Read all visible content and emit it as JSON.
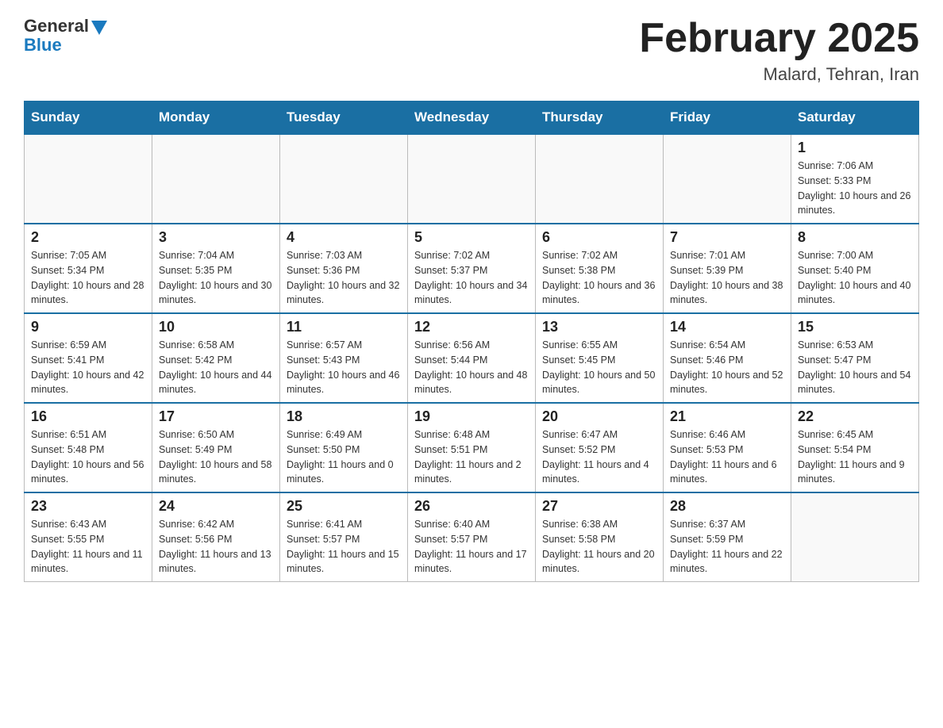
{
  "header": {
    "logo_general": "General",
    "logo_blue": "Blue",
    "month_title": "February 2025",
    "location": "Malard, Tehran, Iran"
  },
  "days_of_week": [
    "Sunday",
    "Monday",
    "Tuesday",
    "Wednesday",
    "Thursday",
    "Friday",
    "Saturday"
  ],
  "weeks": [
    [
      {
        "day": "",
        "sunrise": "",
        "sunset": "",
        "daylight": ""
      },
      {
        "day": "",
        "sunrise": "",
        "sunset": "",
        "daylight": ""
      },
      {
        "day": "",
        "sunrise": "",
        "sunset": "",
        "daylight": ""
      },
      {
        "day": "",
        "sunrise": "",
        "sunset": "",
        "daylight": ""
      },
      {
        "day": "",
        "sunrise": "",
        "sunset": "",
        "daylight": ""
      },
      {
        "day": "",
        "sunrise": "",
        "sunset": "",
        "daylight": ""
      },
      {
        "day": "1",
        "sunrise": "Sunrise: 7:06 AM",
        "sunset": "Sunset: 5:33 PM",
        "daylight": "Daylight: 10 hours and 26 minutes."
      }
    ],
    [
      {
        "day": "2",
        "sunrise": "Sunrise: 7:05 AM",
        "sunset": "Sunset: 5:34 PM",
        "daylight": "Daylight: 10 hours and 28 minutes."
      },
      {
        "day": "3",
        "sunrise": "Sunrise: 7:04 AM",
        "sunset": "Sunset: 5:35 PM",
        "daylight": "Daylight: 10 hours and 30 minutes."
      },
      {
        "day": "4",
        "sunrise": "Sunrise: 7:03 AM",
        "sunset": "Sunset: 5:36 PM",
        "daylight": "Daylight: 10 hours and 32 minutes."
      },
      {
        "day": "5",
        "sunrise": "Sunrise: 7:02 AM",
        "sunset": "Sunset: 5:37 PM",
        "daylight": "Daylight: 10 hours and 34 minutes."
      },
      {
        "day": "6",
        "sunrise": "Sunrise: 7:02 AM",
        "sunset": "Sunset: 5:38 PM",
        "daylight": "Daylight: 10 hours and 36 minutes."
      },
      {
        "day": "7",
        "sunrise": "Sunrise: 7:01 AM",
        "sunset": "Sunset: 5:39 PM",
        "daylight": "Daylight: 10 hours and 38 minutes."
      },
      {
        "day": "8",
        "sunrise": "Sunrise: 7:00 AM",
        "sunset": "Sunset: 5:40 PM",
        "daylight": "Daylight: 10 hours and 40 minutes."
      }
    ],
    [
      {
        "day": "9",
        "sunrise": "Sunrise: 6:59 AM",
        "sunset": "Sunset: 5:41 PM",
        "daylight": "Daylight: 10 hours and 42 minutes."
      },
      {
        "day": "10",
        "sunrise": "Sunrise: 6:58 AM",
        "sunset": "Sunset: 5:42 PM",
        "daylight": "Daylight: 10 hours and 44 minutes."
      },
      {
        "day": "11",
        "sunrise": "Sunrise: 6:57 AM",
        "sunset": "Sunset: 5:43 PM",
        "daylight": "Daylight: 10 hours and 46 minutes."
      },
      {
        "day": "12",
        "sunrise": "Sunrise: 6:56 AM",
        "sunset": "Sunset: 5:44 PM",
        "daylight": "Daylight: 10 hours and 48 minutes."
      },
      {
        "day": "13",
        "sunrise": "Sunrise: 6:55 AM",
        "sunset": "Sunset: 5:45 PM",
        "daylight": "Daylight: 10 hours and 50 minutes."
      },
      {
        "day": "14",
        "sunrise": "Sunrise: 6:54 AM",
        "sunset": "Sunset: 5:46 PM",
        "daylight": "Daylight: 10 hours and 52 minutes."
      },
      {
        "day": "15",
        "sunrise": "Sunrise: 6:53 AM",
        "sunset": "Sunset: 5:47 PM",
        "daylight": "Daylight: 10 hours and 54 minutes."
      }
    ],
    [
      {
        "day": "16",
        "sunrise": "Sunrise: 6:51 AM",
        "sunset": "Sunset: 5:48 PM",
        "daylight": "Daylight: 10 hours and 56 minutes."
      },
      {
        "day": "17",
        "sunrise": "Sunrise: 6:50 AM",
        "sunset": "Sunset: 5:49 PM",
        "daylight": "Daylight: 10 hours and 58 minutes."
      },
      {
        "day": "18",
        "sunrise": "Sunrise: 6:49 AM",
        "sunset": "Sunset: 5:50 PM",
        "daylight": "Daylight: 11 hours and 0 minutes."
      },
      {
        "day": "19",
        "sunrise": "Sunrise: 6:48 AM",
        "sunset": "Sunset: 5:51 PM",
        "daylight": "Daylight: 11 hours and 2 minutes."
      },
      {
        "day": "20",
        "sunrise": "Sunrise: 6:47 AM",
        "sunset": "Sunset: 5:52 PM",
        "daylight": "Daylight: 11 hours and 4 minutes."
      },
      {
        "day": "21",
        "sunrise": "Sunrise: 6:46 AM",
        "sunset": "Sunset: 5:53 PM",
        "daylight": "Daylight: 11 hours and 6 minutes."
      },
      {
        "day": "22",
        "sunrise": "Sunrise: 6:45 AM",
        "sunset": "Sunset: 5:54 PM",
        "daylight": "Daylight: 11 hours and 9 minutes."
      }
    ],
    [
      {
        "day": "23",
        "sunrise": "Sunrise: 6:43 AM",
        "sunset": "Sunset: 5:55 PM",
        "daylight": "Daylight: 11 hours and 11 minutes."
      },
      {
        "day": "24",
        "sunrise": "Sunrise: 6:42 AM",
        "sunset": "Sunset: 5:56 PM",
        "daylight": "Daylight: 11 hours and 13 minutes."
      },
      {
        "day": "25",
        "sunrise": "Sunrise: 6:41 AM",
        "sunset": "Sunset: 5:57 PM",
        "daylight": "Daylight: 11 hours and 15 minutes."
      },
      {
        "day": "26",
        "sunrise": "Sunrise: 6:40 AM",
        "sunset": "Sunset: 5:57 PM",
        "daylight": "Daylight: 11 hours and 17 minutes."
      },
      {
        "day": "27",
        "sunrise": "Sunrise: 6:38 AM",
        "sunset": "Sunset: 5:58 PM",
        "daylight": "Daylight: 11 hours and 20 minutes."
      },
      {
        "day": "28",
        "sunrise": "Sunrise: 6:37 AM",
        "sunset": "Sunset: 5:59 PM",
        "daylight": "Daylight: 11 hours and 22 minutes."
      },
      {
        "day": "",
        "sunrise": "",
        "sunset": "",
        "daylight": ""
      }
    ]
  ]
}
